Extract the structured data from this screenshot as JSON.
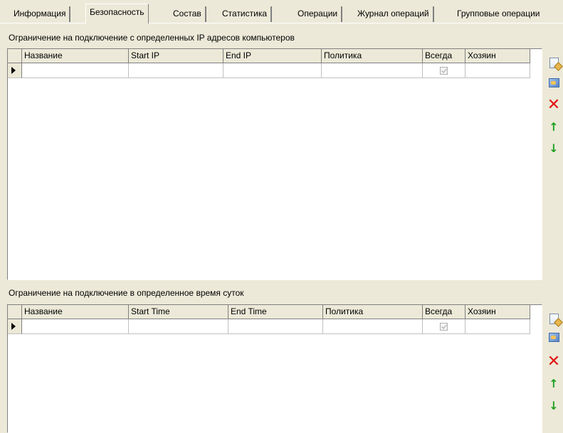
{
  "tabs": [
    {
      "label": "Информация"
    },
    {
      "label": "Безопасность"
    },
    {
      "label": "Состав"
    },
    {
      "label": "Статистика"
    },
    {
      "label": "Операции"
    },
    {
      "label": "Журнал операций"
    },
    {
      "label": "Групповые операции"
    }
  ],
  "active_tab": "Безопасность",
  "ip_section": {
    "title": "Ограничение на подключение с определенных IP адресов компьютеров",
    "columns": [
      "Название",
      "Start IP",
      "End IP",
      "Политика",
      "Всегда",
      "Хозяин"
    ],
    "rows": [
      {
        "name": "",
        "start": "",
        "end": "",
        "policy": "",
        "always": true,
        "owner": ""
      }
    ]
  },
  "time_section": {
    "title": "Ограничение на подключение в определенное время суток",
    "columns": [
      "Название",
      "Start Time",
      "End Time",
      "Политика",
      "Всегда",
      "Хозяин"
    ],
    "rows": [
      {
        "name": "",
        "start": "",
        "end": "",
        "policy": "",
        "always": true,
        "owner": ""
      }
    ]
  },
  "toolbar_icons": [
    "new-document-icon",
    "edit-image-icon",
    "delete-icon",
    "move-up-icon",
    "move-down-icon"
  ]
}
